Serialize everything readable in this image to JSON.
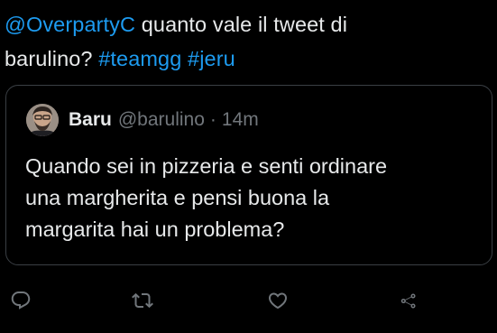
{
  "tweet": {
    "mention": "@OverpartyC",
    "text_part1": " quanto vale il tweet di",
    "text_part2": "barulino?",
    "hashtag1": "#teamgg",
    "hashtag2": "#jeru"
  },
  "quoted_tweet": {
    "author_name": "Baru",
    "author_handle": "@barulino",
    "separator": "·",
    "time": "14m",
    "line1": "Quando sei in pizzeria e senti ordinare",
    "line2": "una margherita e pensi buona la",
    "line3": "margarita hai un problema?"
  },
  "actions": {
    "reply_icon": "reply-icon",
    "retweet_icon": "retweet-icon",
    "like_icon": "heart-icon",
    "share_icon": "share-icon"
  },
  "colors": {
    "background": "#000000",
    "text": "#e7e9ea",
    "link": "#1d9bf0",
    "muted": "#71767b",
    "border": "#3a3f44"
  }
}
